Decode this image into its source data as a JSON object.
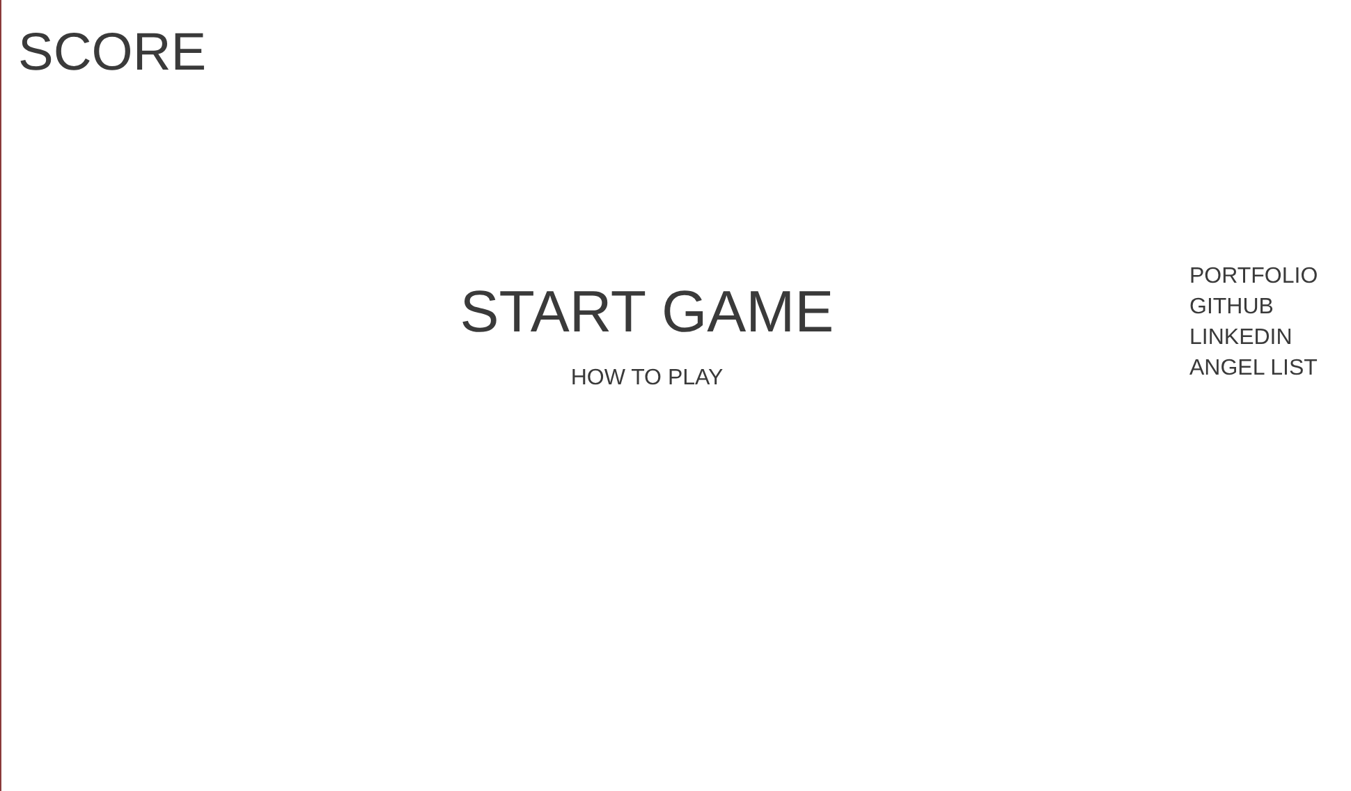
{
  "score": {
    "label": "SCORE"
  },
  "menu": {
    "start": "START GAME",
    "how_to_play": "HOW TO PLAY"
  },
  "links": [
    "PORTFOLIO",
    "GITHUB",
    "LINKEDIN",
    "ANGEL LIST"
  ]
}
